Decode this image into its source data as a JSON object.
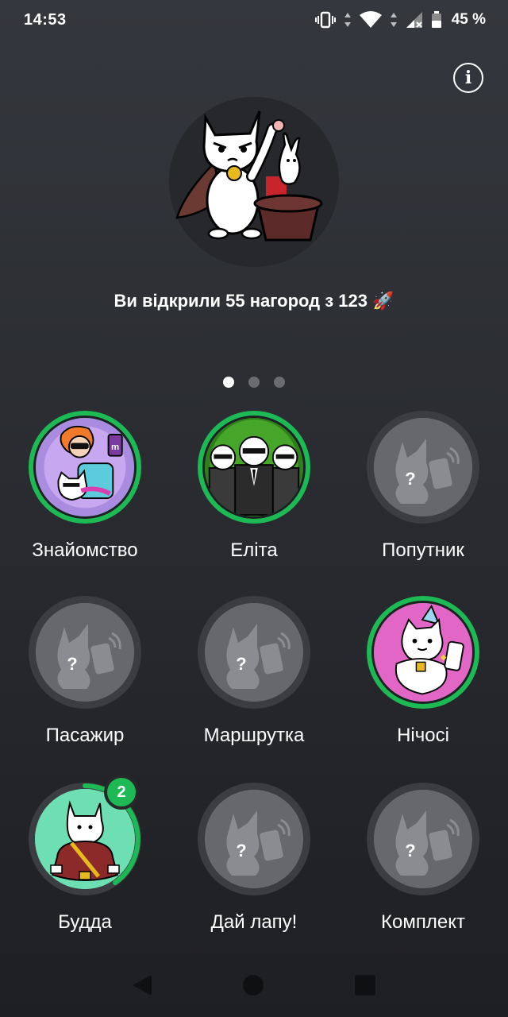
{
  "status": {
    "time": "14:53",
    "battery": "45 %"
  },
  "header": {
    "progress_text": "Ви відкрили 55 нагород з 123",
    "rocket": "🚀"
  },
  "pager": {
    "pages": 3,
    "active": 0
  },
  "badges": [
    {
      "label": "Знайомство",
      "state": "earned"
    },
    {
      "label": "Еліта",
      "state": "earned"
    },
    {
      "label": "Попутник",
      "state": "locked"
    },
    {
      "label": "Пасажир",
      "state": "locked"
    },
    {
      "label": "Маршрутка",
      "state": "locked"
    },
    {
      "label": "Нічосі",
      "state": "earned"
    },
    {
      "label": "Будда",
      "state": "in-progress",
      "count": "2"
    },
    {
      "label": "Дай лапу!",
      "state": "locked"
    },
    {
      "label": "Комплект",
      "state": "locked"
    }
  ],
  "colors": {
    "accent": "#1db954",
    "background": "#2a2c31",
    "locked_fill": "#66686d"
  },
  "icons": {
    "info": "info-icon",
    "back": "nav-back-icon",
    "home": "nav-home-icon",
    "recents": "nav-recents-icon"
  }
}
